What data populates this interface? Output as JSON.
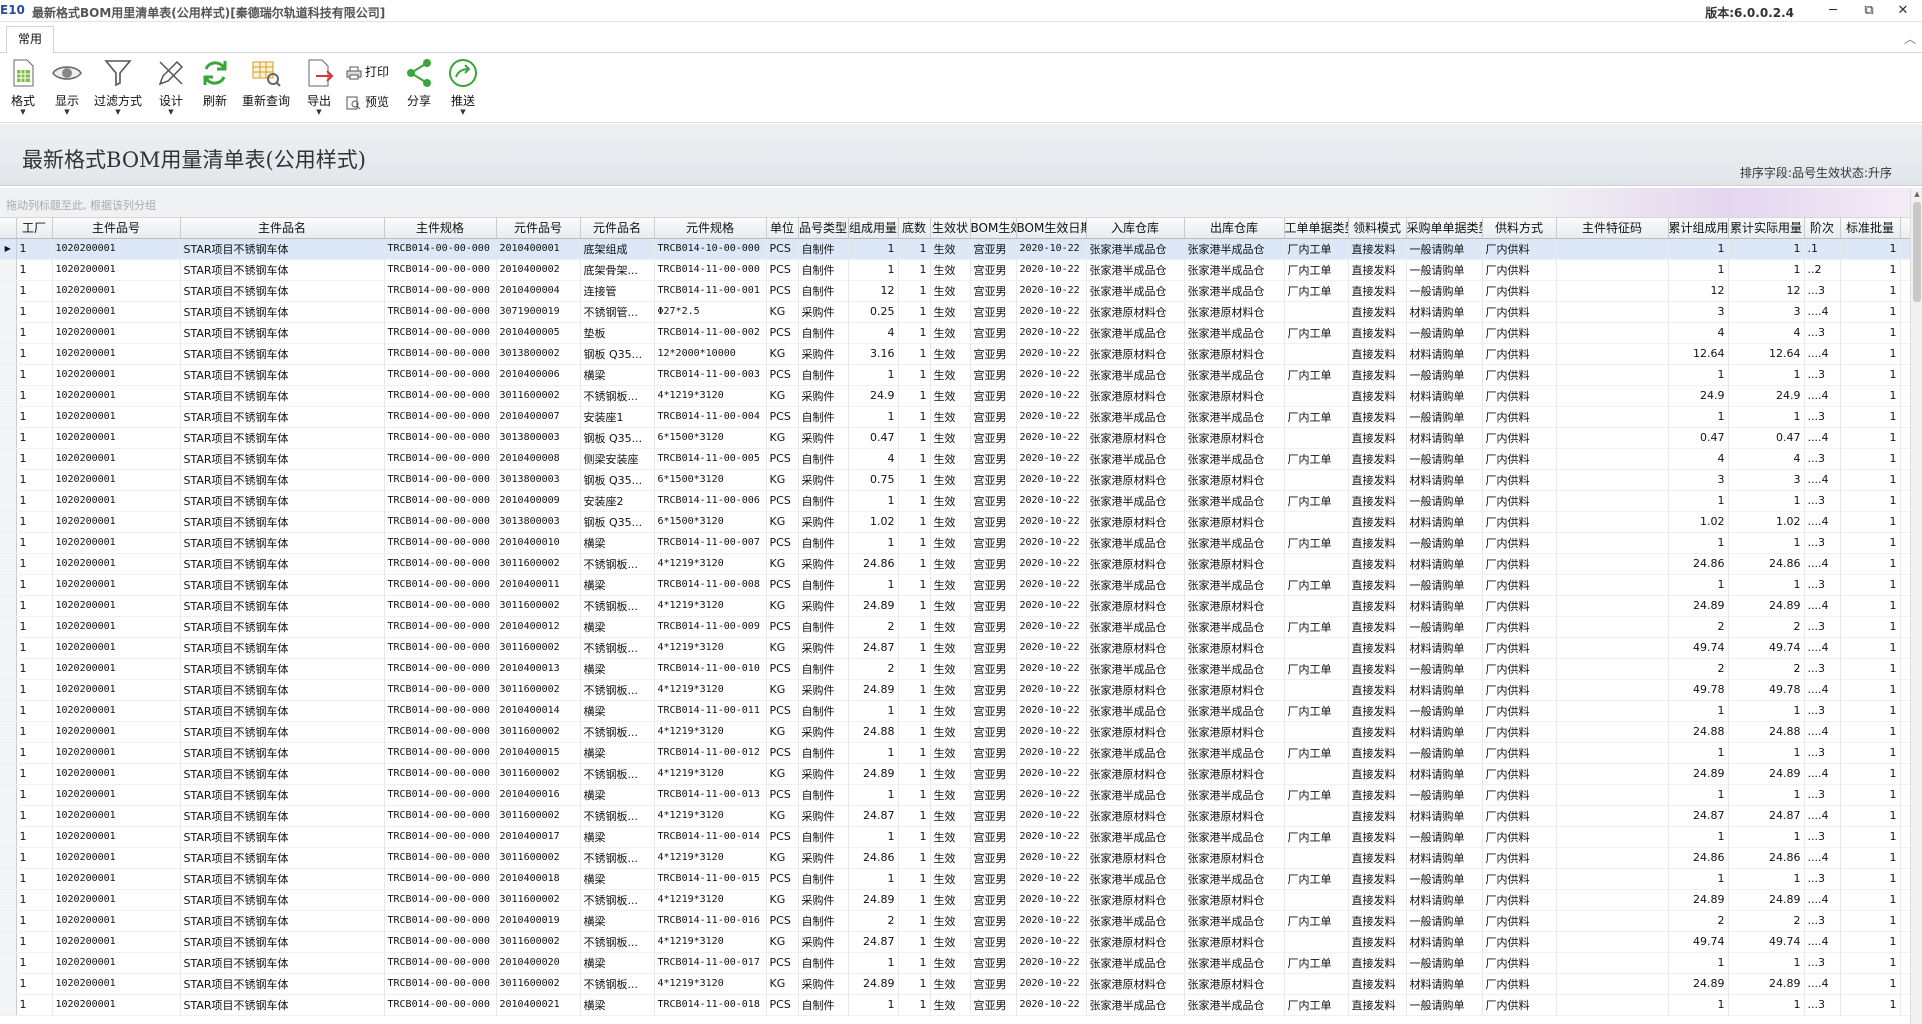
{
  "window": {
    "logo": "E10",
    "title": "最新格式BOM用里清单表(公用样式)[秦德瑞尔轨道科技有限公司]",
    "version": "版本:6.0.0.2.4",
    "minimize": "─",
    "maximize": "⧉",
    "close": "✕"
  },
  "ribbon": {
    "tab": "常用",
    "collapse": "︿",
    "buttons": {
      "format": "格式",
      "display": "显示",
      "filter": "过滤方式",
      "design": "设计",
      "refresh": "刷新",
      "requery": "重新查询",
      "export": "导出",
      "print": "打印",
      "preview": "预览",
      "share": "分享",
      "push": "推送"
    },
    "dropdown_marker": "▼"
  },
  "report": {
    "title": "最新格式BOM用量清单表(公用样式)",
    "sort_info": "排序字段:品号生效状态:升序",
    "group_hint": "拖动列标题至此, 根据该列分组"
  },
  "grid": {
    "columns": [
      "工厂",
      "主件品号",
      "主件品名",
      "主件规格",
      "元件品号",
      "元件品名",
      "元件规格",
      "单位",
      "品号类型",
      "组成用量",
      "底数",
      "生效状",
      "BOM生效",
      "BOM生效日期",
      "入库仓库",
      "出库仓库",
      "工单单据类型",
      "领料模式",
      "采购单单据类型",
      "供料方式",
      "主件特征码",
      "累计组成用量",
      "累计实际用量",
      "阶次",
      "标准批量",
      ""
    ],
    "rows": [
      [
        "1",
        "1020200001",
        "STAR项目不锈钢车体",
        "TRCB014-00-00-000",
        "2010400001",
        "底架组成",
        "TRCB014-10-00-000",
        "PCS",
        "自制件",
        "1",
        "1",
        "生效",
        "宫亚男",
        "2020-10-22",
        "张家港半成品仓",
        "张家港半成品仓",
        "厂内工单",
        "直接发料",
        "一般请购单",
        "厂内供料",
        "",
        "1",
        "1",
        ".1",
        "1",
        ""
      ],
      [
        "1",
        "1020200001",
        "STAR项目不锈钢车体",
        "TRCB014-00-00-000",
        "2010400002",
        "底架骨架...",
        "TRCB014-11-00-000",
        "PCS",
        "自制件",
        "1",
        "1",
        "生效",
        "宫亚男",
        "2020-10-22",
        "张家港半成品仓",
        "张家港半成品仓",
        "厂内工单",
        "直接发料",
        "一般请购单",
        "厂内供料",
        "",
        "1",
        "1",
        "..2",
        "1",
        ""
      ],
      [
        "1",
        "1020200001",
        "STAR项目不锈钢车体",
        "TRCB014-00-00-000",
        "2010400004",
        "连接管",
        "TRCB014-11-00-001",
        "PCS",
        "自制件",
        "12",
        "1",
        "生效",
        "宫亚男",
        "2020-10-22",
        "张家港半成品仓",
        "张家港半成品仓",
        "厂内工单",
        "直接发料",
        "一般请购单",
        "厂内供料",
        "",
        "12",
        "12",
        "...3",
        "1",
        ""
      ],
      [
        "1",
        "1020200001",
        "STAR项目不锈钢车体",
        "TRCB014-00-00-000",
        "3071900019",
        "不锈钢管...",
        "Φ27*2.5",
        "KG",
        "采购件",
        "0.25",
        "1",
        "生效",
        "宫亚男",
        "2020-10-22",
        "张家港原材料仓",
        "张家港原材料仓",
        "",
        "直接发料",
        "材料请购单",
        "厂内供料",
        "",
        "3",
        "3",
        "....4",
        "1",
        ""
      ],
      [
        "1",
        "1020200001",
        "STAR项目不锈钢车体",
        "TRCB014-00-00-000",
        "2010400005",
        "垫板",
        "TRCB014-11-00-002",
        "PCS",
        "自制件",
        "4",
        "1",
        "生效",
        "宫亚男",
        "2020-10-22",
        "张家港半成品仓",
        "张家港半成品仓",
        "厂内工单",
        "直接发料",
        "一般请购单",
        "厂内供料",
        "",
        "4",
        "4",
        "...3",
        "1",
        ""
      ],
      [
        "1",
        "1020200001",
        "STAR项目不锈钢车体",
        "TRCB014-00-00-000",
        "3013800002",
        "钢板 Q35...",
        "12*2000*10000",
        "KG",
        "采购件",
        "3.16",
        "1",
        "生效",
        "宫亚男",
        "2020-10-22",
        "张家港原材料仓",
        "张家港原材料仓",
        "",
        "直接发料",
        "材料请购单",
        "厂内供料",
        "",
        "12.64",
        "12.64",
        "....4",
        "1",
        ""
      ],
      [
        "1",
        "1020200001",
        "STAR项目不锈钢车体",
        "TRCB014-00-00-000",
        "2010400006",
        "横梁",
        "TRCB014-11-00-003",
        "PCS",
        "自制件",
        "1",
        "1",
        "生效",
        "宫亚男",
        "2020-10-22",
        "张家港半成品仓",
        "张家港半成品仓",
        "厂内工单",
        "直接发料",
        "一般请购单",
        "厂内供料",
        "",
        "1",
        "1",
        "...3",
        "1",
        ""
      ],
      [
        "1",
        "1020200001",
        "STAR项目不锈钢车体",
        "TRCB014-00-00-000",
        "3011600002",
        "不锈钢板...",
        "4*1219*3120",
        "KG",
        "采购件",
        "24.9",
        "1",
        "生效",
        "宫亚男",
        "2020-10-22",
        "张家港原材料仓",
        "张家港原材料仓",
        "",
        "直接发料",
        "材料请购单",
        "厂内供料",
        "",
        "24.9",
        "24.9",
        "....4",
        "1",
        ""
      ],
      [
        "1",
        "1020200001",
        "STAR项目不锈钢车体",
        "TRCB014-00-00-000",
        "2010400007",
        "安装座1",
        "TRCB014-11-00-004",
        "PCS",
        "自制件",
        "1",
        "1",
        "生效",
        "宫亚男",
        "2020-10-22",
        "张家港半成品仓",
        "张家港半成品仓",
        "厂内工单",
        "直接发料",
        "一般请购单",
        "厂内供料",
        "",
        "1",
        "1",
        "...3",
        "1",
        ""
      ],
      [
        "1",
        "1020200001",
        "STAR项目不锈钢车体",
        "TRCB014-00-00-000",
        "3013800003",
        "钢板 Q35...",
        "6*1500*3120",
        "KG",
        "采购件",
        "0.47",
        "1",
        "生效",
        "宫亚男",
        "2020-10-22",
        "张家港原材料仓",
        "张家港原材料仓",
        "",
        "直接发料",
        "材料请购单",
        "厂内供料",
        "",
        "0.47",
        "0.47",
        "....4",
        "1",
        ""
      ],
      [
        "1",
        "1020200001",
        "STAR项目不锈钢车体",
        "TRCB014-00-00-000",
        "2010400008",
        "侧梁安装座",
        "TRCB014-11-00-005",
        "PCS",
        "自制件",
        "4",
        "1",
        "生效",
        "宫亚男",
        "2020-10-22",
        "张家港半成品仓",
        "张家港半成品仓",
        "厂内工单",
        "直接发料",
        "一般请购单",
        "厂内供料",
        "",
        "4",
        "4",
        "...3",
        "1",
        ""
      ],
      [
        "1",
        "1020200001",
        "STAR项目不锈钢车体",
        "TRCB014-00-00-000",
        "3013800003",
        "钢板 Q35...",
        "6*1500*3120",
        "KG",
        "采购件",
        "0.75",
        "1",
        "生效",
        "宫亚男",
        "2020-10-22",
        "张家港原材料仓",
        "张家港原材料仓",
        "",
        "直接发料",
        "材料请购单",
        "厂内供料",
        "",
        "3",
        "3",
        "....4",
        "1",
        ""
      ],
      [
        "1",
        "1020200001",
        "STAR项目不锈钢车体",
        "TRCB014-00-00-000",
        "2010400009",
        "安装座2",
        "TRCB014-11-00-006",
        "PCS",
        "自制件",
        "1",
        "1",
        "生效",
        "宫亚男",
        "2020-10-22",
        "张家港半成品仓",
        "张家港半成品仓",
        "厂内工单",
        "直接发料",
        "一般请购单",
        "厂内供料",
        "",
        "1",
        "1",
        "...3",
        "1",
        ""
      ],
      [
        "1",
        "1020200001",
        "STAR项目不锈钢车体",
        "TRCB014-00-00-000",
        "3013800003",
        "钢板 Q35...",
        "6*1500*3120",
        "KG",
        "采购件",
        "1.02",
        "1",
        "生效",
        "宫亚男",
        "2020-10-22",
        "张家港原材料仓",
        "张家港原材料仓",
        "",
        "直接发料",
        "材料请购单",
        "厂内供料",
        "",
        "1.02",
        "1.02",
        "....4",
        "1",
        ""
      ],
      [
        "1",
        "1020200001",
        "STAR项目不锈钢车体",
        "TRCB014-00-00-000",
        "2010400010",
        "横梁",
        "TRCB014-11-00-007",
        "PCS",
        "自制件",
        "1",
        "1",
        "生效",
        "宫亚男",
        "2020-10-22",
        "张家港半成品仓",
        "张家港半成品仓",
        "厂内工单",
        "直接发料",
        "一般请购单",
        "厂内供料",
        "",
        "1",
        "1",
        "...3",
        "1",
        ""
      ],
      [
        "1",
        "1020200001",
        "STAR项目不锈钢车体",
        "TRCB014-00-00-000",
        "3011600002",
        "不锈钢板...",
        "4*1219*3120",
        "KG",
        "采购件",
        "24.86",
        "1",
        "生效",
        "宫亚男",
        "2020-10-22",
        "张家港原材料仓",
        "张家港原材料仓",
        "",
        "直接发料",
        "材料请购单",
        "厂内供料",
        "",
        "24.86",
        "24.86",
        "....4",
        "1",
        ""
      ],
      [
        "1",
        "1020200001",
        "STAR项目不锈钢车体",
        "TRCB014-00-00-000",
        "2010400011",
        "横梁",
        "TRCB014-11-00-008",
        "PCS",
        "自制件",
        "1",
        "1",
        "生效",
        "宫亚男",
        "2020-10-22",
        "张家港半成品仓",
        "张家港半成品仓",
        "厂内工单",
        "直接发料",
        "一般请购单",
        "厂内供料",
        "",
        "1",
        "1",
        "...3",
        "1",
        ""
      ],
      [
        "1",
        "1020200001",
        "STAR项目不锈钢车体",
        "TRCB014-00-00-000",
        "3011600002",
        "不锈钢板...",
        "4*1219*3120",
        "KG",
        "采购件",
        "24.89",
        "1",
        "生效",
        "宫亚男",
        "2020-10-22",
        "张家港原材料仓",
        "张家港原材料仓",
        "",
        "直接发料",
        "材料请购单",
        "厂内供料",
        "",
        "24.89",
        "24.89",
        "....4",
        "1",
        ""
      ],
      [
        "1",
        "1020200001",
        "STAR项目不锈钢车体",
        "TRCB014-00-00-000",
        "2010400012",
        "横梁",
        "TRCB014-11-00-009",
        "PCS",
        "自制件",
        "2",
        "1",
        "生效",
        "宫亚男",
        "2020-10-22",
        "张家港半成品仓",
        "张家港半成品仓",
        "厂内工单",
        "直接发料",
        "一般请购单",
        "厂内供料",
        "",
        "2",
        "2",
        "...3",
        "1",
        ""
      ],
      [
        "1",
        "1020200001",
        "STAR项目不锈钢车体",
        "TRCB014-00-00-000",
        "3011600002",
        "不锈钢板...",
        "4*1219*3120",
        "KG",
        "采购件",
        "24.87",
        "1",
        "生效",
        "宫亚男",
        "2020-10-22",
        "张家港原材料仓",
        "张家港原材料仓",
        "",
        "直接发料",
        "材料请购单",
        "厂内供料",
        "",
        "49.74",
        "49.74",
        "....4",
        "1",
        ""
      ],
      [
        "1",
        "1020200001",
        "STAR项目不锈钢车体",
        "TRCB014-00-00-000",
        "2010400013",
        "横梁",
        "TRCB014-11-00-010",
        "PCS",
        "自制件",
        "2",
        "1",
        "生效",
        "宫亚男",
        "2020-10-22",
        "张家港半成品仓",
        "张家港半成品仓",
        "厂内工单",
        "直接发料",
        "一般请购单",
        "厂内供料",
        "",
        "2",
        "2",
        "...3",
        "1",
        ""
      ],
      [
        "1",
        "1020200001",
        "STAR项目不锈钢车体",
        "TRCB014-00-00-000",
        "3011600002",
        "不锈钢板...",
        "4*1219*3120",
        "KG",
        "采购件",
        "24.89",
        "1",
        "生效",
        "宫亚男",
        "2020-10-22",
        "张家港原材料仓",
        "张家港原材料仓",
        "",
        "直接发料",
        "材料请购单",
        "厂内供料",
        "",
        "49.78",
        "49.78",
        "....4",
        "1",
        ""
      ],
      [
        "1",
        "1020200001",
        "STAR项目不锈钢车体",
        "TRCB014-00-00-000",
        "2010400014",
        "横梁",
        "TRCB014-11-00-011",
        "PCS",
        "自制件",
        "1",
        "1",
        "生效",
        "宫亚男",
        "2020-10-22",
        "张家港半成品仓",
        "张家港半成品仓",
        "厂内工单",
        "直接发料",
        "一般请购单",
        "厂内供料",
        "",
        "1",
        "1",
        "...3",
        "1",
        ""
      ],
      [
        "1",
        "1020200001",
        "STAR项目不锈钢车体",
        "TRCB014-00-00-000",
        "3011600002",
        "不锈钢板...",
        "4*1219*3120",
        "KG",
        "采购件",
        "24.88",
        "1",
        "生效",
        "宫亚男",
        "2020-10-22",
        "张家港原材料仓",
        "张家港原材料仓",
        "",
        "直接发料",
        "材料请购单",
        "厂内供料",
        "",
        "24.88",
        "24.88",
        "....4",
        "1",
        ""
      ],
      [
        "1",
        "1020200001",
        "STAR项目不锈钢车体",
        "TRCB014-00-00-000",
        "2010400015",
        "横梁",
        "TRCB014-11-00-012",
        "PCS",
        "自制件",
        "1",
        "1",
        "生效",
        "宫亚男",
        "2020-10-22",
        "张家港半成品仓",
        "张家港半成品仓",
        "厂内工单",
        "直接发料",
        "一般请购单",
        "厂内供料",
        "",
        "1",
        "1",
        "...3",
        "1",
        ""
      ],
      [
        "1",
        "1020200001",
        "STAR项目不锈钢车体",
        "TRCB014-00-00-000",
        "3011600002",
        "不锈钢板...",
        "4*1219*3120",
        "KG",
        "采购件",
        "24.89",
        "1",
        "生效",
        "宫亚男",
        "2020-10-22",
        "张家港原材料仓",
        "张家港原材料仓",
        "",
        "直接发料",
        "材料请购单",
        "厂内供料",
        "",
        "24.89",
        "24.89",
        "....4",
        "1",
        ""
      ],
      [
        "1",
        "1020200001",
        "STAR项目不锈钢车体",
        "TRCB014-00-00-000",
        "2010400016",
        "横梁",
        "TRCB014-11-00-013",
        "PCS",
        "自制件",
        "1",
        "1",
        "生效",
        "宫亚男",
        "2020-10-22",
        "张家港半成品仓",
        "张家港半成品仓",
        "厂内工单",
        "直接发料",
        "一般请购单",
        "厂内供料",
        "",
        "1",
        "1",
        "...3",
        "1",
        ""
      ],
      [
        "1",
        "1020200001",
        "STAR项目不锈钢车体",
        "TRCB014-00-00-000",
        "3011600002",
        "不锈钢板...",
        "4*1219*3120",
        "KG",
        "采购件",
        "24.87",
        "1",
        "生效",
        "宫亚男",
        "2020-10-22",
        "张家港原材料仓",
        "张家港原材料仓",
        "",
        "直接发料",
        "材料请购单",
        "厂内供料",
        "",
        "24.87",
        "24.87",
        "....4",
        "1",
        ""
      ],
      [
        "1",
        "1020200001",
        "STAR项目不锈钢车体",
        "TRCB014-00-00-000",
        "2010400017",
        "横梁",
        "TRCB014-11-00-014",
        "PCS",
        "自制件",
        "1",
        "1",
        "生效",
        "宫亚男",
        "2020-10-22",
        "张家港半成品仓",
        "张家港半成品仓",
        "厂内工单",
        "直接发料",
        "一般请购单",
        "厂内供料",
        "",
        "1",
        "1",
        "...3",
        "1",
        ""
      ],
      [
        "1",
        "1020200001",
        "STAR项目不锈钢车体",
        "TRCB014-00-00-000",
        "3011600002",
        "不锈钢板...",
        "4*1219*3120",
        "KG",
        "采购件",
        "24.86",
        "1",
        "生效",
        "宫亚男",
        "2020-10-22",
        "张家港原材料仓",
        "张家港原材料仓",
        "",
        "直接发料",
        "材料请购单",
        "厂内供料",
        "",
        "24.86",
        "24.86",
        "....4",
        "1",
        ""
      ],
      [
        "1",
        "1020200001",
        "STAR项目不锈钢车体",
        "TRCB014-00-00-000",
        "2010400018",
        "横梁",
        "TRCB014-11-00-015",
        "PCS",
        "自制件",
        "1",
        "1",
        "生效",
        "宫亚男",
        "2020-10-22",
        "张家港半成品仓",
        "张家港半成品仓",
        "厂内工单",
        "直接发料",
        "一般请购单",
        "厂内供料",
        "",
        "1",
        "1",
        "...3",
        "1",
        ""
      ],
      [
        "1",
        "1020200001",
        "STAR项目不锈钢车体",
        "TRCB014-00-00-000",
        "3011600002",
        "不锈钢板...",
        "4*1219*3120",
        "KG",
        "采购件",
        "24.89",
        "1",
        "生效",
        "宫亚男",
        "2020-10-22",
        "张家港原材料仓",
        "张家港原材料仓",
        "",
        "直接发料",
        "材料请购单",
        "厂内供料",
        "",
        "24.89",
        "24.89",
        "....4",
        "1",
        ""
      ],
      [
        "1",
        "1020200001",
        "STAR项目不锈钢车体",
        "TRCB014-00-00-000",
        "2010400019",
        "横梁",
        "TRCB014-11-00-016",
        "PCS",
        "自制件",
        "2",
        "1",
        "生效",
        "宫亚男",
        "2020-10-22",
        "张家港半成品仓",
        "张家港半成品仓",
        "厂内工单",
        "直接发料",
        "一般请购单",
        "厂内供料",
        "",
        "2",
        "2",
        "...3",
        "1",
        ""
      ],
      [
        "1",
        "1020200001",
        "STAR项目不锈钢车体",
        "TRCB014-00-00-000",
        "3011600002",
        "不锈钢板...",
        "4*1219*3120",
        "KG",
        "采购件",
        "24.87",
        "1",
        "生效",
        "宫亚男",
        "2020-10-22",
        "张家港原材料仓",
        "张家港原材料仓",
        "",
        "直接发料",
        "材料请购单",
        "厂内供料",
        "",
        "49.74",
        "49.74",
        "....4",
        "1",
        ""
      ],
      [
        "1",
        "1020200001",
        "STAR项目不锈钢车体",
        "TRCB014-00-00-000",
        "2010400020",
        "横梁",
        "TRCB014-11-00-017",
        "PCS",
        "自制件",
        "1",
        "1",
        "生效",
        "宫亚男",
        "2020-10-22",
        "张家港半成品仓",
        "张家港半成品仓",
        "厂内工单",
        "直接发料",
        "一般请购单",
        "厂内供料",
        "",
        "1",
        "1",
        "...3",
        "1",
        ""
      ],
      [
        "1",
        "1020200001",
        "STAR项目不锈钢车体",
        "TRCB014-00-00-000",
        "3011600002",
        "不锈钢板...",
        "4*1219*3120",
        "KG",
        "采购件",
        "24.89",
        "1",
        "生效",
        "宫亚男",
        "2020-10-22",
        "张家港原材料仓",
        "张家港原材料仓",
        "",
        "直接发料",
        "材料请购单",
        "厂内供料",
        "",
        "24.89",
        "24.89",
        "....4",
        "1",
        ""
      ],
      [
        "1",
        "1020200001",
        "STAR项目不锈钢车体",
        "TRCB014-00-00-000",
        "2010400021",
        "横梁",
        "TRCB014-11-00-018",
        "PCS",
        "自制件",
        "1",
        "1",
        "生效",
        "宫亚男",
        "2020-10-22",
        "张家港半成品仓",
        "张家港半成品仓",
        "厂内工单",
        "直接发料",
        "一般请购单",
        "厂内供料",
        "",
        "1",
        "1",
        "...3",
        "1",
        ""
      ]
    ],
    "selected_row": 0,
    "current_row_marker": "▶",
    "right_aligned_columns": [
      9,
      10,
      21,
      22,
      24
    ],
    "mono_columns": [
      1,
      3,
      4,
      6,
      13
    ]
  },
  "colors": {
    "accent": "#2c4a9a",
    "selected_row": "#dce7f7",
    "header_bg": "#e9ebee"
  }
}
